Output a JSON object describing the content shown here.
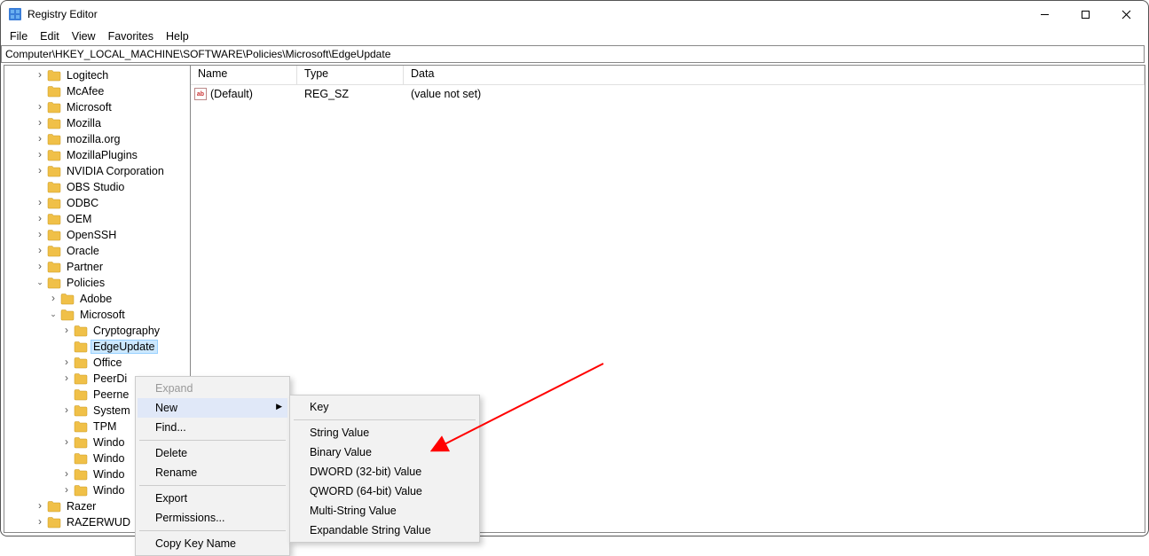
{
  "window": {
    "title": "Registry Editor"
  },
  "menubar": [
    "File",
    "Edit",
    "View",
    "Favorites",
    "Help"
  ],
  "addressbar": "Computer\\HKEY_LOCAL_MACHINE\\SOFTWARE\\Policies\\Microsoft\\EdgeUpdate",
  "tree": [
    {
      "indent": 2,
      "chev": "closed",
      "label": "Logitech"
    },
    {
      "indent": 2,
      "chev": "none",
      "label": "McAfee"
    },
    {
      "indent": 2,
      "chev": "closed",
      "label": "Microsoft"
    },
    {
      "indent": 2,
      "chev": "closed",
      "label": "Mozilla"
    },
    {
      "indent": 2,
      "chev": "closed",
      "label": "mozilla.org"
    },
    {
      "indent": 2,
      "chev": "closed",
      "label": "MozillaPlugins"
    },
    {
      "indent": 2,
      "chev": "closed",
      "label": "NVIDIA Corporation"
    },
    {
      "indent": 2,
      "chev": "none",
      "label": "OBS Studio"
    },
    {
      "indent": 2,
      "chev": "closed",
      "label": "ODBC"
    },
    {
      "indent": 2,
      "chev": "closed",
      "label": "OEM"
    },
    {
      "indent": 2,
      "chev": "closed",
      "label": "OpenSSH"
    },
    {
      "indent": 2,
      "chev": "closed",
      "label": "Oracle"
    },
    {
      "indent": 2,
      "chev": "closed",
      "label": "Partner"
    },
    {
      "indent": 2,
      "chev": "open",
      "label": "Policies"
    },
    {
      "indent": 3,
      "chev": "closed",
      "label": "Adobe"
    },
    {
      "indent": 3,
      "chev": "open",
      "label": "Microsoft"
    },
    {
      "indent": 4,
      "chev": "closed",
      "label": "Cryptography"
    },
    {
      "indent": 4,
      "chev": "none",
      "label": "EdgeUpdate",
      "selected": true
    },
    {
      "indent": 4,
      "chev": "closed",
      "label": "Office"
    },
    {
      "indent": 4,
      "chev": "closed",
      "label": "PeerDi"
    },
    {
      "indent": 4,
      "chev": "none",
      "label": "Peerne"
    },
    {
      "indent": 4,
      "chev": "closed",
      "label": "System"
    },
    {
      "indent": 4,
      "chev": "none",
      "label": "TPM"
    },
    {
      "indent": 4,
      "chev": "closed",
      "label": "Windo"
    },
    {
      "indent": 4,
      "chev": "none",
      "label": "Windo"
    },
    {
      "indent": 4,
      "chev": "closed",
      "label": "Windo"
    },
    {
      "indent": 4,
      "chev": "closed",
      "label": "Windo"
    },
    {
      "indent": 2,
      "chev": "closed",
      "label": "Razer"
    },
    {
      "indent": 2,
      "chev": "closed",
      "label": "RAZERWUD"
    }
  ],
  "values": {
    "headers": {
      "name": "Name",
      "type": "Type",
      "data": "Data"
    },
    "rows": [
      {
        "name": "(Default)",
        "type": "REG_SZ",
        "data": "(value not set)"
      }
    ]
  },
  "context_menu1": {
    "expand": "Expand",
    "new": "New",
    "find": "Find...",
    "delete": "Delete",
    "rename": "Rename",
    "export": "Export",
    "permissions": "Permissions...",
    "copykey": "Copy Key Name"
  },
  "context_menu2": {
    "key": "Key",
    "string": "String Value",
    "binary": "Binary Value",
    "dword": "DWORD (32-bit) Value",
    "qword": "QWORD (64-bit) Value",
    "multi": "Multi-String Value",
    "expand": "Expandable String Value"
  }
}
